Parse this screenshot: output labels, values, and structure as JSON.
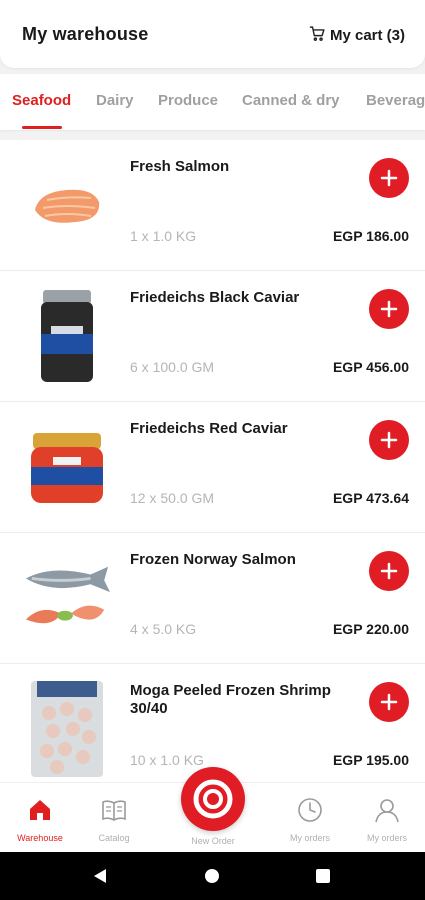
{
  "header": {
    "title": "My warehouse",
    "cart_label": "My cart (3)"
  },
  "tabs": [
    {
      "label": "Seafood",
      "active": true
    },
    {
      "label": "Dairy",
      "active": false
    },
    {
      "label": "Produce",
      "active": false
    },
    {
      "label": "Canned & dry",
      "active": false
    },
    {
      "label": "Beverag",
      "active": false
    }
  ],
  "products": [
    {
      "name": "Fresh Salmon",
      "qty": "1 x 1.0 KG",
      "price": "EGP 186.00",
      "icon": "salmon-fillet-image"
    },
    {
      "name": "Friedeichs Black Caviar",
      "qty": "6 x 100.0 GM",
      "price": "EGP 456.00",
      "icon": "black-caviar-jar-image"
    },
    {
      "name": "Friedeichs Red Caviar",
      "qty": "12 x 50.0 GM",
      "price": "EGP 473.64",
      "icon": "red-caviar-jar-image"
    },
    {
      "name": "Frozen Norway Salmon",
      "qty": "4 x 5.0 KG",
      "price": "EGP 220.00",
      "icon": "whole-salmon-image"
    },
    {
      "name": "Moga Peeled Frozen Shrimp 30/40",
      "qty": "10 x 1.0 KG",
      "price": "EGP 195.00",
      "icon": "shrimp-bag-image"
    }
  ],
  "bottom_nav": {
    "warehouse": "Warehouse",
    "catalog": "Catalog",
    "new_order": "New Order",
    "my_orders_1": "My orders",
    "my_orders_2": "My orders"
  },
  "colors": {
    "accent": "#e01c24",
    "inactive_text": "#a0a0a0"
  }
}
